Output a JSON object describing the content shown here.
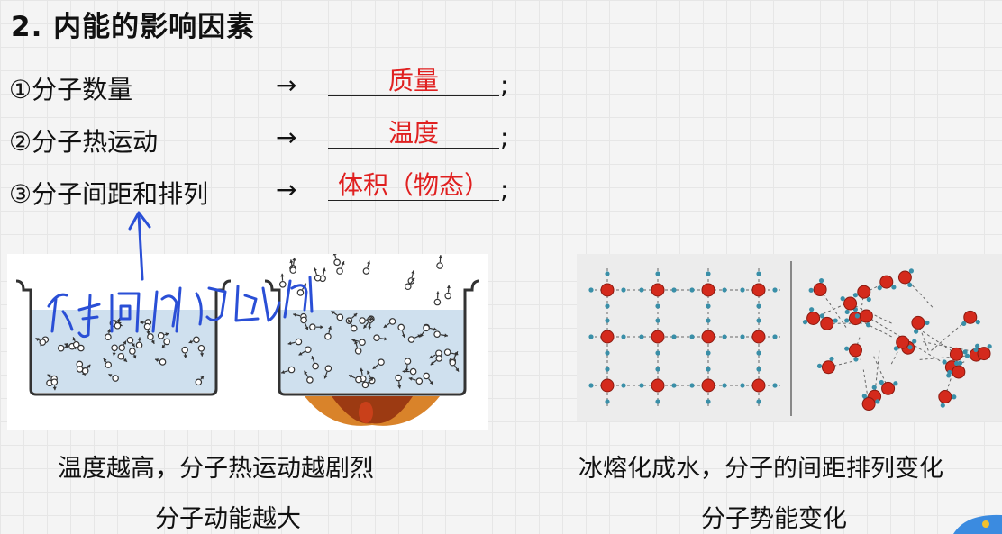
{
  "heading": "2. 内能的影响因素",
  "factors": [
    {
      "label": "①分子数量",
      "arrow": "→",
      "answer": "质量",
      "end": ";"
    },
    {
      "label": "②分子热运动",
      "arrow": "→",
      "answer": "温度",
      "end": ";"
    },
    {
      "label": "③分子间距和排列",
      "arrow": "→",
      "answer": "体积（物态）",
      "end": ";"
    }
  ],
  "left_figure": {
    "caption_line1": "温度越高，分子热运动越剧烈",
    "caption_line2": "分子动能越大"
  },
  "right_figure": {
    "caption_line1": "冰熔化成水，分子的间距排列变化",
    "caption_line2": "分子势能变化"
  },
  "colors": {
    "answer": "#e02020",
    "ink": "#2a4fd6",
    "oxygen": "#d42a1c",
    "hydrogen": "#3a8fa8",
    "water": "#cfe0ee",
    "flame": "#b8481a"
  }
}
